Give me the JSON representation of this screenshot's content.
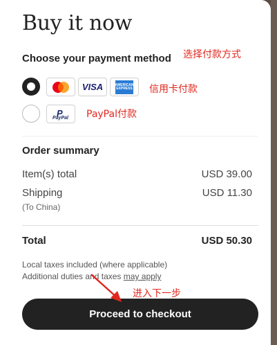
{
  "modal": {
    "title": "Buy it now"
  },
  "payment": {
    "heading": "Choose your payment method",
    "options": [
      {
        "id": "cards",
        "selected": true,
        "cards": [
          "mastercard",
          "visa",
          "amex"
        ],
        "visa_label": "VISA",
        "amex_label": "AMERICAN EXPRESS"
      },
      {
        "id": "paypal",
        "selected": false,
        "label": "PayPal"
      }
    ]
  },
  "annotations": {
    "choose_method": "选择付款方式",
    "card_pay": "信用卡付款",
    "paypal_pay": "PayPal付款",
    "next_step": "进入下一步"
  },
  "summary": {
    "heading": "Order summary",
    "items_label": "Item(s) total",
    "items_value": "USD 39.00",
    "shipping_label": "Shipping",
    "shipping_value": "USD 11.30",
    "shipping_note": "(To China)",
    "total_label": "Total",
    "total_value": "USD 50.30",
    "tax_note_1": "Local taxes included (where applicable)",
    "tax_note_2_prefix": "Additional duties and taxes ",
    "tax_note_2_link": "may apply"
  },
  "checkout": {
    "label": "Proceed to checkout"
  },
  "colors": {
    "annotation": "#e0271e",
    "button": "#222222",
    "mastercard_red": "#eb001b",
    "mastercard_orange": "#f79e1b",
    "amex_blue": "#2a7bd4"
  }
}
